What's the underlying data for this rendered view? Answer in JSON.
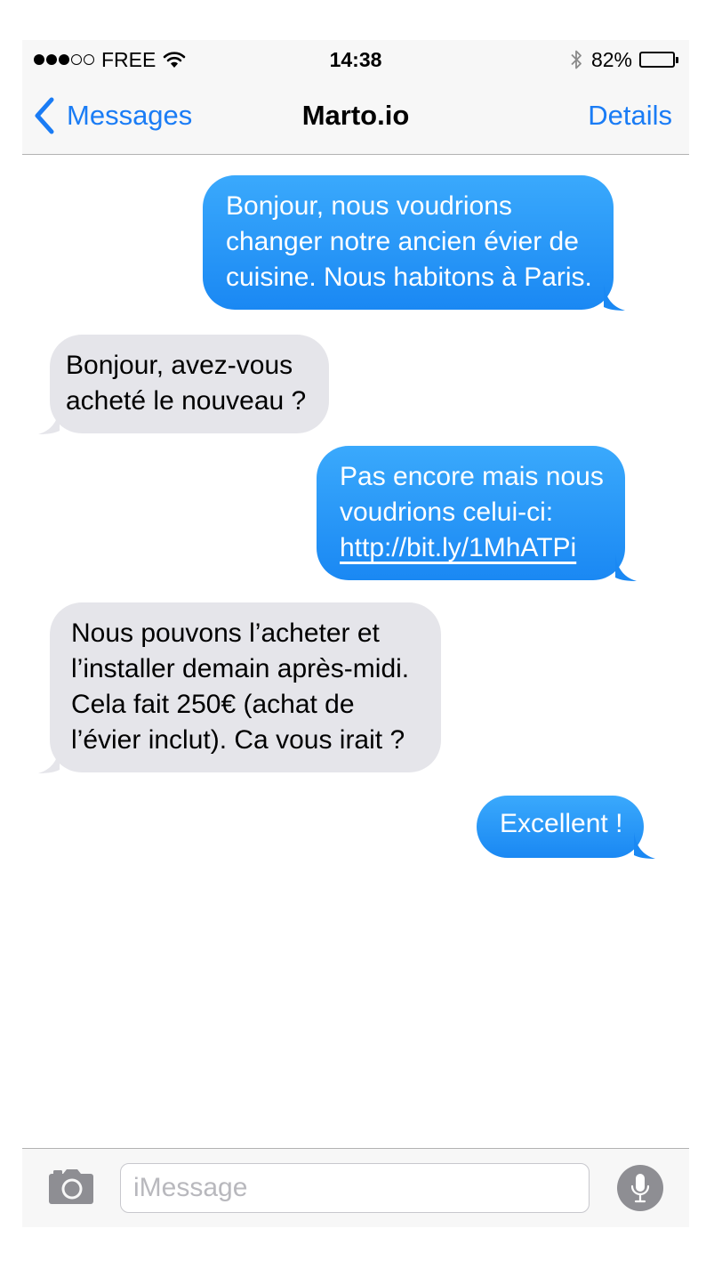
{
  "status_bar": {
    "carrier": "FREE",
    "signal_dots": [
      true,
      true,
      true,
      false,
      false
    ],
    "time": "14:38",
    "battery_percent_label": "82%",
    "battery_level": 0.82
  },
  "nav": {
    "back_label": "Messages",
    "title": "Marto.io",
    "details_label": "Details"
  },
  "messages": [
    {
      "direction": "outgoing",
      "lines": [
        "Bonjour, nous voudrions",
        "changer notre ancien évier de",
        "cuisine. Nous habitons à Paris."
      ]
    },
    {
      "direction": "incoming",
      "lines": [
        "Bonjour, avez-vous",
        "acheté le nouveau ?"
      ]
    },
    {
      "direction": "outgoing",
      "lines": [
        "Pas encore mais nous",
        "voudrions celui-ci:"
      ],
      "link": "http://bit.ly/1MhATPi"
    },
    {
      "direction": "incoming",
      "lines": [
        "Nous pouvons l’acheter et",
        "l’installer demain après-midi.",
        "Cela fait 250€ (achat de",
        "l’évier inclut). Ca vous irait ?"
      ]
    },
    {
      "direction": "outgoing",
      "lines": [
        "Excellent !"
      ]
    }
  ],
  "input_bar": {
    "placeholder": "iMessage",
    "value": ""
  },
  "colors": {
    "ios_blue": "#1a7cf5",
    "outgoing_bubble_top": "#3aa9fc",
    "outgoing_bubble_bottom": "#1a88f3",
    "incoming_bubble": "#e5e5ea",
    "bar_background": "#f7f7f7",
    "mic_button": "#8e8e93"
  },
  "icons": {
    "back": "chevron-left-icon",
    "wifi": "wifi-icon",
    "bluetooth": "bluetooth-icon",
    "battery": "battery-icon",
    "camera": "camera-icon",
    "mic": "microphone-icon"
  }
}
